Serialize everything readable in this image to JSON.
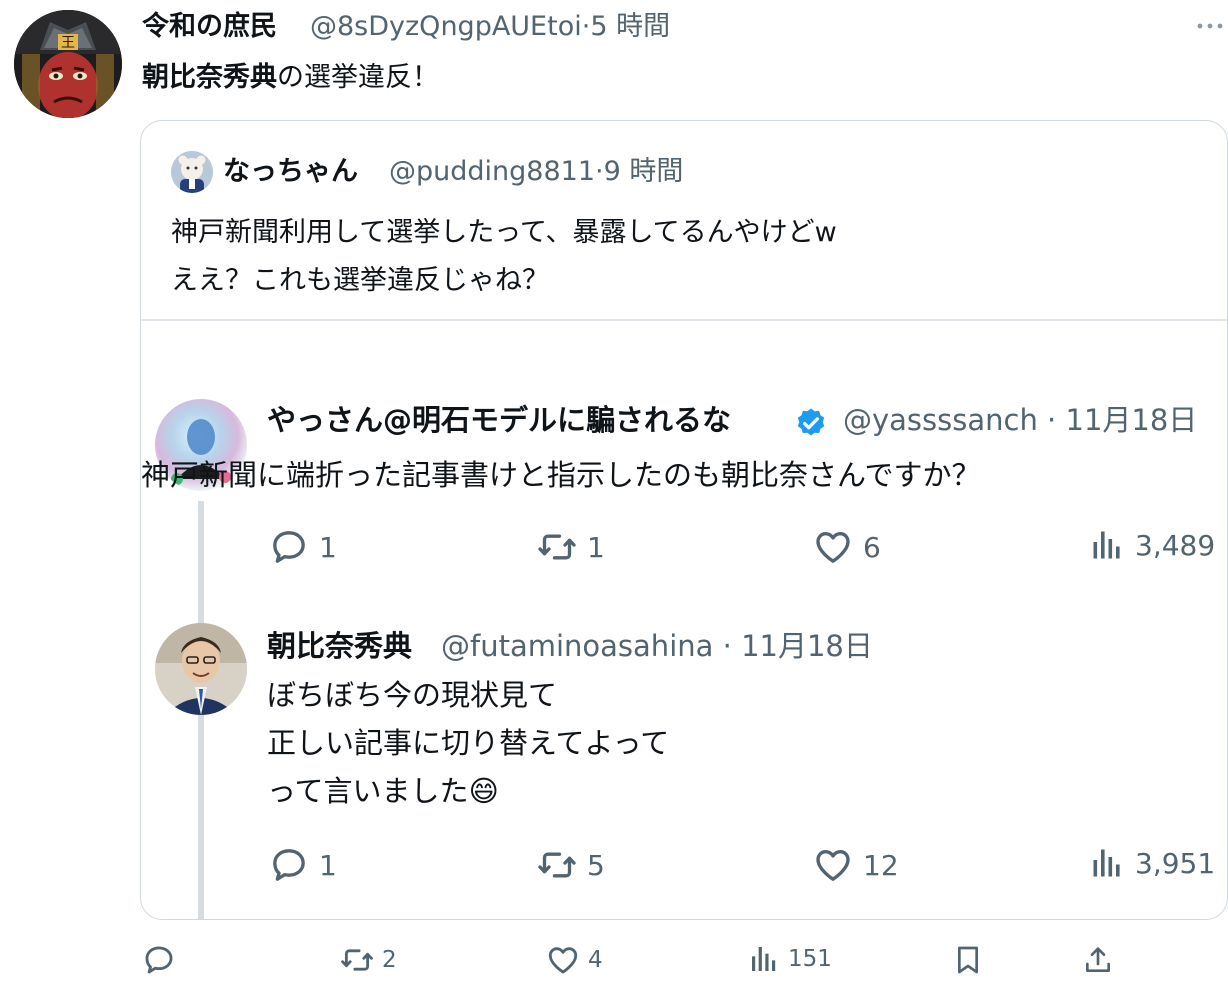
{
  "main_tweet": {
    "author_name": "令和の庶民",
    "handle": "@8sDyzQngpAUEtoi",
    "separator": "·",
    "time": "5 時間",
    "text_bold": "朝比奈秀典",
    "text_rest": "の選挙違反！",
    "more_icon": "more-dots-icon",
    "actions": {
      "reply_count": "",
      "repost_count": "2",
      "like_count": "4",
      "views_count": "151"
    }
  },
  "quoted_tweet": {
    "author_name": "なっちゃん",
    "handle": "@pudding8811",
    "separator": "·",
    "time": "9 時間",
    "lines": [
      "神戸新聞利用して選挙したって、暴露してるんやけどw",
      "ええ？これも選挙違反じゃね？"
    ]
  },
  "embedded_thread": [
    {
      "author_name": "やっさん@明石モデルに騙されるな",
      "verified": true,
      "handle": "@yassssanch",
      "date": "11月18日",
      "lines": [
        "神戸新聞に端折った記事書けと指示したのも朝比奈さんですか？"
      ],
      "reply_count": "1",
      "repost_count": "1",
      "like_count": "6",
      "views_count": "3,489"
    },
    {
      "author_name": "朝比奈秀典",
      "verified": false,
      "handle": "@futaminoasahina",
      "date": "11月18日",
      "lines": [
        "ぼちぼち今の現状見て",
        "正しい記事に切り替えてよって",
        "って言いました"
      ],
      "emoji": "😄",
      "reply_count": "1",
      "repost_count": "5",
      "like_count": "12",
      "views_count": "3,951"
    }
  ],
  "colors": {
    "text": "#0f1419",
    "secondary": "#536471",
    "border": "#cfd9de",
    "verified": "#1d9bf0"
  }
}
